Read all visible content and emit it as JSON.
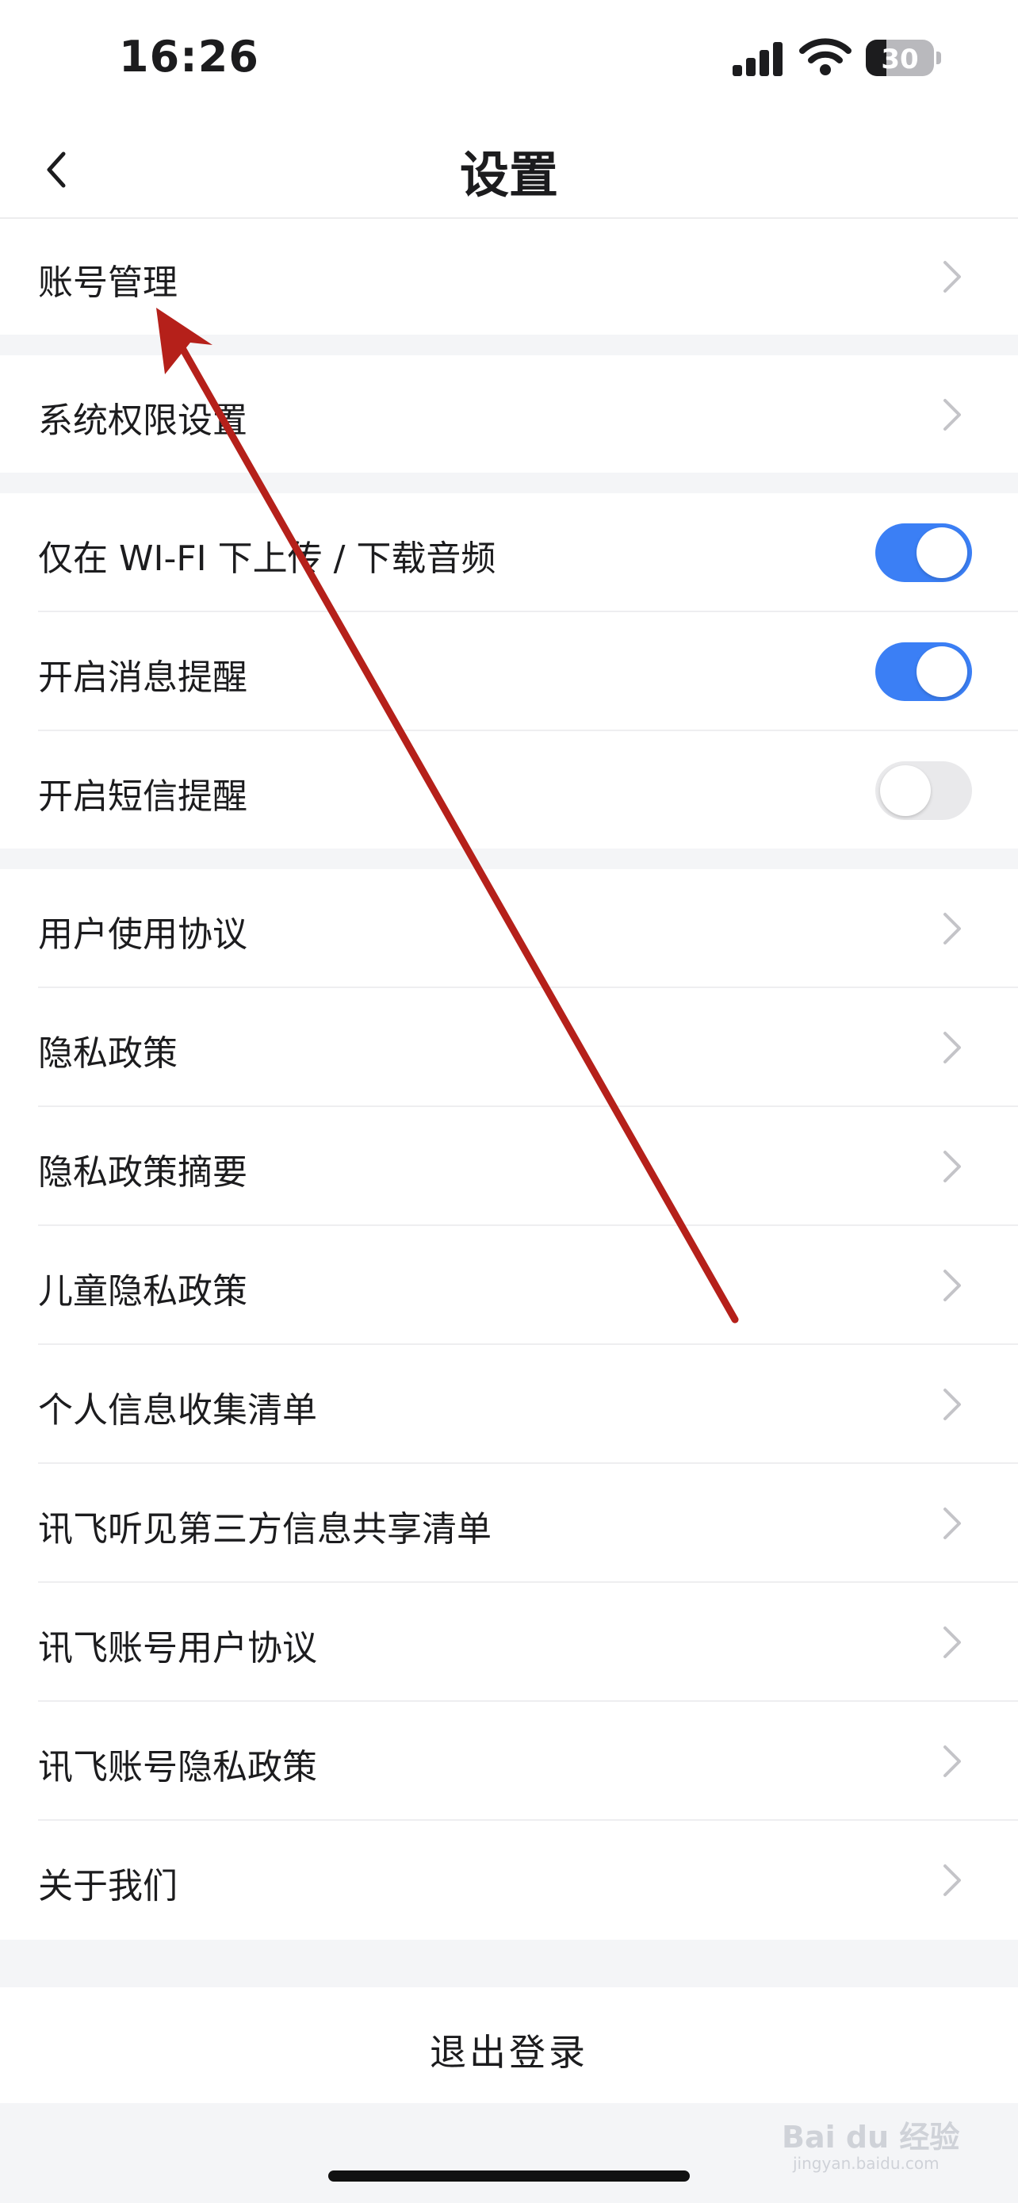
{
  "status_bar": {
    "time": "16:26",
    "battery": "30",
    "battery_level": 0.3
  },
  "nav": {
    "title": "设置",
    "back_icon": "chevron-left-icon"
  },
  "groups": {
    "account": {
      "account_management": "账号管理"
    },
    "permissions": {
      "system_permissions": "系统权限设置"
    },
    "toggles": [
      {
        "label": "仅在 WI-FI 下上传 / 下载音频",
        "on": true
      },
      {
        "label": "开启消息提醒",
        "on": true
      },
      {
        "label": "开启短信提醒",
        "on": false
      }
    ],
    "links": [
      "用户使用协议",
      "隐私政策",
      "隐私政策摘要",
      "儿童隐私政策",
      "个人信息收集清单",
      "讯飞听见第三方信息共享清单",
      "讯飞账号用户协议",
      "讯飞账号隐私政策",
      "关于我们"
    ]
  },
  "logout": {
    "label": "退出登录"
  },
  "watermark": {
    "text": "Bai du 经验",
    "sub": "jingyan.baidu.com"
  },
  "colors": {
    "toggle_on": "#3b7ff5",
    "annotation_arrow": "#b5201a",
    "background": "#f4f5f7"
  }
}
